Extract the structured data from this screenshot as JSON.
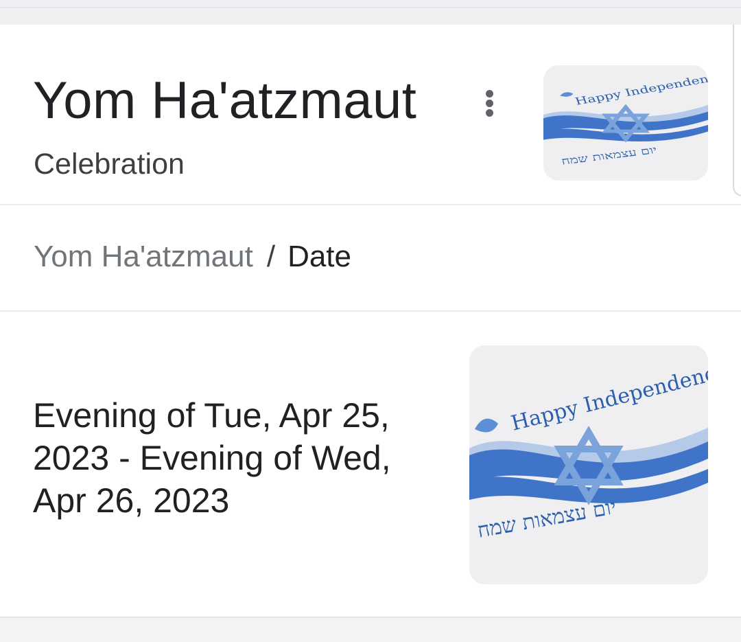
{
  "header": {
    "title": "Yom Ha'atzmaut",
    "subtitle": "Celebration",
    "more_options_icon": "more-vert-icon"
  },
  "image": {
    "caption_top": "Happy Independence Day",
    "caption_bottom": "יום עצמאות שמח",
    "colors": {
      "wave_dark": "#3f74c8",
      "wave_light": "#9dbbe6",
      "star": "#7aa3dc",
      "text": "#2b5fae"
    }
  },
  "breadcrumb": {
    "parent": "Yom Ha'atzmaut",
    "separator": "/",
    "current": "Date"
  },
  "answer": {
    "date_range": "Evening of Tue, Apr 25, 2023 - Evening of Wed, Apr 26, 2023"
  }
}
